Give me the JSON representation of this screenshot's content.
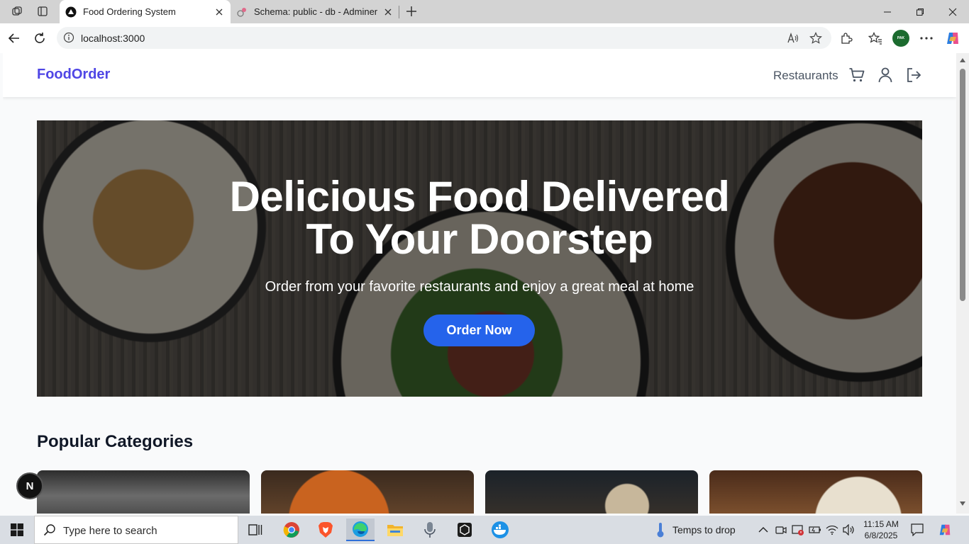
{
  "browser": {
    "tabs": [
      {
        "title": "Food Ordering System",
        "active": true
      },
      {
        "title": "Schema: public - db - Adminer",
        "active": false
      }
    ],
    "url": "localhost:3000"
  },
  "site": {
    "brand": "FoodOrder",
    "nav": {
      "restaurants": "Restaurants"
    },
    "hero": {
      "line1": "Delicious Food Delivered",
      "line2": "To Your Doorstep",
      "subtitle": "Order from your favorite restaurants and enjoy a great meal at home",
      "cta": "Order Now"
    },
    "popular_title": "Popular Categories",
    "next_badge": "N"
  },
  "taskbar": {
    "search_placeholder": "Type here to search",
    "weather": "Temps to drop",
    "time": "11:15 AM",
    "date": "6/8/2025"
  },
  "colors": {
    "brand": "#4f46e5",
    "cta": "#2563eb"
  }
}
